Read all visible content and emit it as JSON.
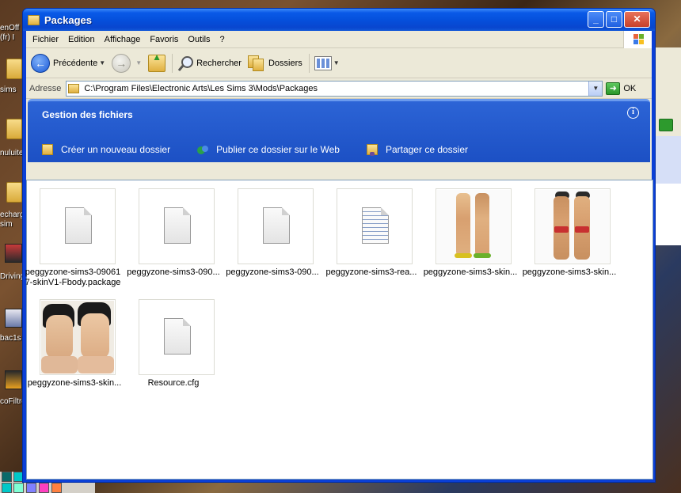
{
  "desktop": {
    "icon_captions": [
      "enOff",
      "(fr) I",
      "sims",
      "nuluite",
      "echarg",
      "sim",
      "Driving",
      "bac1s",
      "coFiltro"
    ]
  },
  "window": {
    "title": "Packages",
    "buttons": {
      "minimize": "_",
      "maximize": "□",
      "close": "✕"
    }
  },
  "menu": [
    "Fichier",
    "Edition",
    "Affichage",
    "Favoris",
    "Outils",
    "?"
  ],
  "toolbar": {
    "back_label": "Précédente",
    "search_label": "Rechercher",
    "folders_label": "Dossiers"
  },
  "address": {
    "label": "Adresse",
    "path": "C:\\Program Files\\Electronic Arts\\Les Sims 3\\Mods\\Packages",
    "go_label": "OK"
  },
  "taskpane": {
    "title": "Gestion des fichiers",
    "tasks": [
      "Créer un nouveau dossier",
      "Publier ce dossier sur le Web",
      "Partager ce dossier"
    ]
  },
  "files": [
    {
      "label_line1": "peggyzone-sims3-09061",
      "label_line2": "7-skinV1-Fbody.package",
      "icon": "blank-document-icon"
    },
    {
      "label_line1": "peggyzone-sims3-090...",
      "icon": "blank-document-icon"
    },
    {
      "label_line1": "peggyzone-sims3-090...",
      "icon": "blank-document-icon"
    },
    {
      "label_line1": "peggyzone-sims3-rea...",
      "icon": "text-document-icon"
    },
    {
      "label_line1": "peggyzone-sims3-skin...",
      "icon": "female-figures-thumbnail"
    },
    {
      "label_line1": "peggyzone-sims3-skin...",
      "icon": "male-figures-thumbnail"
    },
    {
      "label_line1": "peggyzone-sims3-skin...",
      "icon": "male-faces-thumbnail"
    },
    {
      "label_line1": "Resource.cfg",
      "icon": "blank-document-icon"
    }
  ],
  "colors": {
    "title_blue": "#0550dc",
    "chrome": "#ece9d8",
    "taskpane_blue": "#1c50c4"
  }
}
